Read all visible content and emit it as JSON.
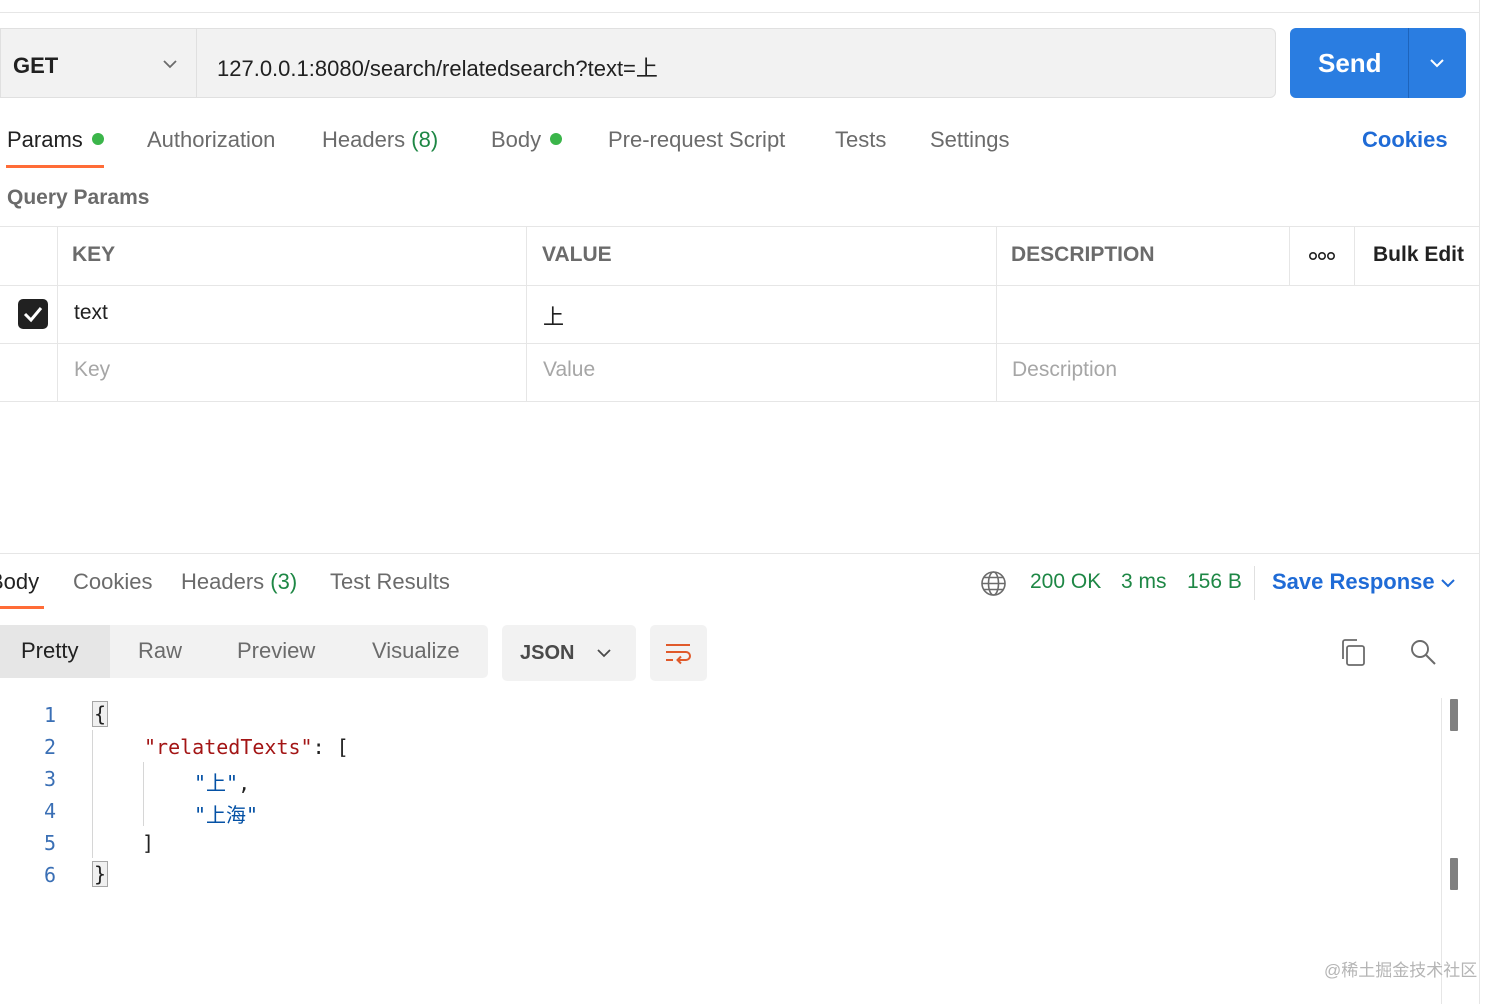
{
  "request": {
    "method": "GET",
    "url": "127.0.0.1:8080/search/relatedsearch?text=上",
    "send_label": "Send"
  },
  "request_tabs": [
    {
      "label": "Params",
      "dot": true,
      "active": true
    },
    {
      "label": "Authorization"
    },
    {
      "label": "Headers",
      "count": "(8)"
    },
    {
      "label": "Body",
      "dot": true
    },
    {
      "label": "Pre-request Script"
    },
    {
      "label": "Tests"
    },
    {
      "label": "Settings"
    }
  ],
  "cookies_link": "Cookies",
  "query_params": {
    "title": "Query Params",
    "headers": {
      "key": "KEY",
      "value": "VALUE",
      "description": "DESCRIPTION",
      "bulk_edit": "Bulk Edit"
    },
    "rows": [
      {
        "checked": true,
        "key": "text",
        "value": "上",
        "description": ""
      }
    ],
    "placeholders": {
      "key": "Key",
      "value": "Value",
      "description": "Description"
    }
  },
  "response": {
    "tabs": [
      {
        "label": "Body",
        "active": true
      },
      {
        "label": "Cookies"
      },
      {
        "label": "Headers",
        "count": "(3)"
      },
      {
        "label": "Test Results"
      }
    ],
    "status": "200 OK",
    "time": "3 ms",
    "size": "156 B",
    "save_response": "Save Response",
    "views": [
      "Pretty",
      "Raw",
      "Preview",
      "Visualize"
    ],
    "active_view": "Pretty",
    "format": "JSON",
    "code": {
      "line_numbers": [
        "1",
        "2",
        "3",
        "4",
        "5",
        "6"
      ],
      "open_brace": "{",
      "key": "\"relatedTexts\"",
      "key_sep": ": [",
      "values": [
        "\"上\"",
        "\"上海\""
      ],
      "value_sep": ",",
      "close_bracket": "]",
      "close_brace": "}"
    }
  },
  "watermark": "@稀土掘金技术社区",
  "colors": {
    "accent": "#ff6c37",
    "primary": "#2a7de1",
    "success": "#1e8745",
    "link": "#1f6bd6"
  },
  "icons": [
    "chevron-down-icon",
    "more-horizontal-icon",
    "check-icon",
    "globe-icon",
    "wrap-lines-icon",
    "copy-icon",
    "search-icon"
  ]
}
